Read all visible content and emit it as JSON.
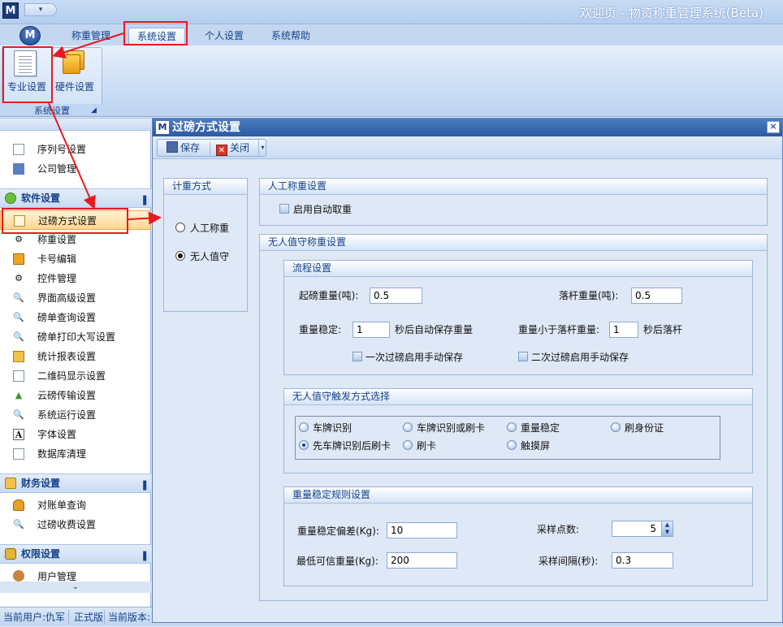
{
  "window": {
    "app_logo": "M",
    "qat_glyph": "▾",
    "title": "欢迎页 - 物资称重管理系统(Beta)"
  },
  "ribbon": {
    "orb": "M",
    "tabs": [
      "称重管理",
      "系统设置",
      "个人设置",
      "系统帮助"
    ],
    "active_tab": "系统设置",
    "group_label": "系统设置",
    "buttons": [
      {
        "label": "专业设置",
        "icon": "document-icon"
      },
      {
        "label": "硬件设置",
        "icon": "hardware-icon"
      }
    ]
  },
  "sidebar": {
    "top_items": [
      {
        "label": "序列号设置",
        "icon": "list-icon"
      },
      {
        "label": "公司管理",
        "icon": "org-icon"
      }
    ],
    "sections": [
      {
        "title": "软件设置",
        "items": [
          "过磅方式设置",
          "称重设置",
          "卡号编辑",
          "控件管理",
          "界面高级设置",
          "磅单查询设置",
          "磅单打印大写设置",
          "统计报表设置",
          "二维码显示设置",
          "云磅传输设置",
          "系统运行设置",
          "字体设置",
          "数据库清理"
        ]
      },
      {
        "title": "财务设置",
        "items": [
          "对账单查询",
          "过磅收费设置"
        ]
      },
      {
        "title": "权限设置",
        "items": [
          "用户管理"
        ]
      }
    ],
    "selected": "过磅方式设置",
    "collapse_glyph": "▌",
    "scroll_glyph": "⌄"
  },
  "status": {
    "user": "当前用户:仇军",
    "edition": "正式版",
    "version": "当前版本:"
  },
  "dialog": {
    "logo": "M",
    "title": "过磅方式设置",
    "close": "×",
    "toolbar": {
      "save": "保存",
      "close": "关闭",
      "more": "▾"
    },
    "weigh_mode": {
      "title": "计重方式",
      "options": [
        "人工称重",
        "无人值守"
      ],
      "selected": "无人值守"
    },
    "manual": {
      "title": "人工称重设置",
      "auto_weight": "启用自动取重"
    },
    "unattended": {
      "title": "无人值守称重设置",
      "flow": {
        "title": "流程设置",
        "start_weight_label": "起磅重量(吨):",
        "start_weight": "0.5",
        "drop_weight_label": "落杆重量(吨):",
        "drop_weight": "0.5",
        "stable_label": "重量稳定:",
        "stable_secs": "1",
        "stable_suffix": "秒后自动保存重量",
        "below_label": "重量小于落杆重量:",
        "below_secs": "1",
        "below_suffix": "秒后落杆",
        "manual_save_first": "一次过磅启用手动保存",
        "manual_save_second": "二次过磅启用手动保存"
      },
      "trigger": {
        "title": "无人值守触发方式选择",
        "options": [
          "车牌识别",
          "车牌识别或刷卡",
          "重量稳定",
          "刷身份证",
          "先车牌识别后刷卡",
          "刷卡",
          "触摸屏"
        ],
        "selected": "先车牌识别后刷卡"
      },
      "stability": {
        "title": "重量稳定规则设置",
        "deviation_label": "重量稳定偏差(Kg):",
        "deviation": "10",
        "sample_points_label": "采样点数:",
        "sample_points": "5",
        "min_weight_label": "最低可信重量(Kg):",
        "min_weight": "200",
        "sample_interval_label": "采样间隔(秒):",
        "sample_interval": "0.3"
      }
    }
  },
  "colors": {
    "annotation_red": "#e8191f",
    "selection": "#ffd690",
    "title_blue": "#2b5aa2"
  }
}
